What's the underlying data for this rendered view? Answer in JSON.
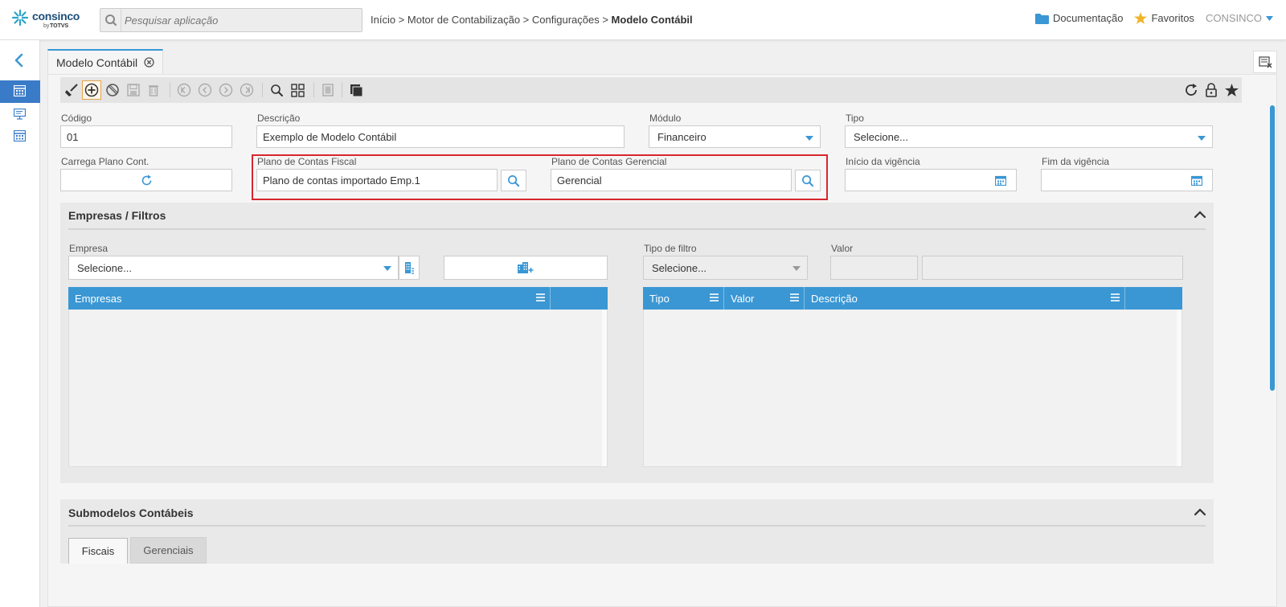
{
  "header": {
    "logo_name": "consinco",
    "logo_by": "by",
    "logo_totvs": "TOTVS",
    "search_placeholder": "Pesquisar aplicação",
    "breadcrumb_path": "Início > Motor de Contabilização > Configurações > ",
    "breadcrumb_current": "Modelo Contábil",
    "documentation": "Documentação",
    "favorites": "Favoritos",
    "user": "CONSINCO"
  },
  "tab": {
    "title": "Modelo Contábil"
  },
  "form": {
    "codigo_label": "Código",
    "codigo_value": "01",
    "descricao_label": "Descrição",
    "descricao_value": "Exemplo de Modelo Contábil",
    "modulo_label": "Módulo",
    "modulo_value": "Financeiro",
    "tipo_label": "Tipo",
    "tipo_value": "Selecione...",
    "carrega_label": "Carrega Plano Cont.",
    "plano_fiscal_label": "Plano de Contas Fiscal",
    "plano_fiscal_value": "Plano de contas importado Emp.1",
    "plano_gerencial_label": "Plano de Contas Gerencial",
    "plano_gerencial_value": "Gerencial",
    "inicio_label": "Início da vigência",
    "fim_label": "Fim da vigência"
  },
  "empresas_section": {
    "title": "Empresas / Filtros",
    "empresa_label": "Empresa",
    "empresa_value": "Selecione...",
    "tipo_filtro_label": "Tipo de filtro",
    "tipo_filtro_value": "Selecione...",
    "valor_label": "Valor",
    "empresas_grid_columns": [
      "Empresas"
    ],
    "filtro_grid_columns": [
      "Tipo",
      "Valor",
      "Descrição"
    ]
  },
  "submodelos_section": {
    "title": "Submodelos Contábeis",
    "tabs": [
      "Fiscais",
      "Gerenciais"
    ]
  },
  "colors": {
    "accent": "#3a97d4",
    "highlight": "#d7262e",
    "sidebar_active": "#3a7bc8"
  }
}
